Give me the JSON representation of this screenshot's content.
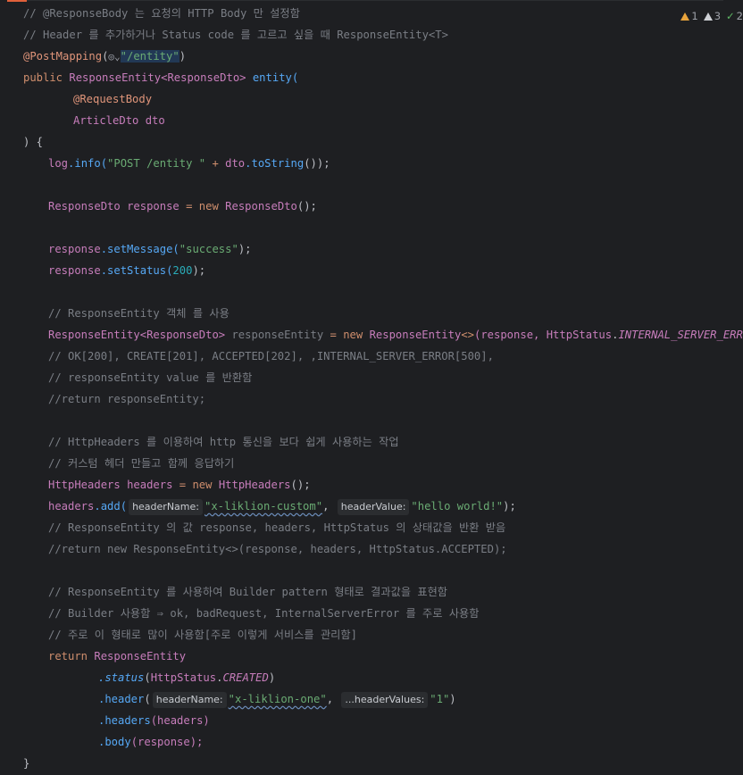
{
  "inspections": {
    "errors": "1",
    "warnings": "3",
    "ok": "2"
  },
  "code": {
    "l1": "// @ResponseBody 는 요청의 HTTP Body 만 설정함",
    "l2": "// Header 를 추가하거나 Status code 를 고르고 싶을 때 ResponseEntity<T>",
    "l3_ann": "@PostMapping",
    "l3_url": "\"/entity\"",
    "l4_public": "public",
    "l4_type": "ResponseEntity",
    "l4_generic": "<ResponseDto>",
    "l4_name": "entity(",
    "l5": "@RequestBody",
    "l6_type": "ArticleDto",
    "l6_var": "dto",
    "l7": ") {",
    "l8_log": "log",
    "l8_info": ".info(",
    "l8_str": "\"POST /entity \"",
    "l8_plus": " + ",
    "l8_dto": "dto",
    "l8_tostr": ".toString",
    "l8_end": "());",
    "l10_type": "ResponseDto",
    "l10_var": "response",
    "l10_eq": " = ",
    "l10_new": "new",
    "l10_cls": "ResponseDto",
    "l10_end": "();",
    "l12_var": "response",
    "l12_fn": ".setMessage(",
    "l12_str": "\"success\"",
    "l12_end": ");",
    "l13_var": "response",
    "l13_fn": ".setStatus(",
    "l13_num": "200",
    "l13_end": ");",
    "l15": "// ResponseEntity 객체 를 사용",
    "l16_type": "ResponseEntity",
    "l16_gen": "<ResponseDto>",
    "l16_var": "responseEntity",
    "l16_eq": " = ",
    "l16_new": "new",
    "l16_cls": "ResponseEntity",
    "l16_diamond": "<>",
    "l16_args": "(response, ",
    "l16_hs": "HttpStatus",
    "l16_dot": ".",
    "l16_field": "INTERNAL_SERVER_ERROR",
    "l16_end": ");",
    "l17": "// OK[200], CREATE[201], ACCEPTED[202], ,INTERNAL_SERVER_ERROR[500],",
    "l18": "// responseEntity value 를 반환함",
    "l19": "//return responseEntity;",
    "l21": "// HttpHeaders 를 이용하여 http 통신을 보다 쉽게 사용하는 작업",
    "l22": "// 커스텀 헤더 만들고 함께 응답하기",
    "l23_type": "HttpHeaders",
    "l23_var": "headers",
    "l23_eq": " = ",
    "l23_new": "new",
    "l23_cls": "HttpHeaders",
    "l23_end": "();",
    "l24_var": "headers",
    "l24_fn": ".add(",
    "l24_hint1": "headerName:",
    "l24_str1": "\"x-liklion-custom\"",
    "l24_comma": ",",
    "l24_hint2": "headerValue:",
    "l24_str2": "\"hello world!\"",
    "l24_end": ");",
    "l25": "// ResponseEntity 의 값 response, headers, HttpStatus 의 상태값을 반환 받음",
    "l26": "//return new ResponseEntity<>(response, headers, HttpStatus.ACCEPTED);",
    "l28": "// ResponseEntity 를 사용하여 Builder pattern 형태로 결과값을 표현함",
    "l29": "// Builder 사용함 ⇒ ok, badRequest, InternalServerError 를 주로 사용함",
    "l30": "// 주로 이 형태로 많이 사용함[주로 이렇게 서비스를 관리함]",
    "l31_ret": "return",
    "l31_cls": "ResponseEntity",
    "l32_fn": ".status",
    "l32_open": "(",
    "l32_hs": "HttpStatus",
    "l32_dot": ".",
    "l32_field": "CREATED",
    "l32_end": ")",
    "l33_fn": ".header",
    "l33_open": "(",
    "l33_hint1": "headerName:",
    "l33_str1": "\"x-liklion-one\"",
    "l33_comma": ",",
    "l33_hint2": "...headerValues:",
    "l33_str2": "\"1\"",
    "l33_end": ")",
    "l34_fn": ".headers",
    "l34_arg": "(headers)",
    "l35_fn": ".body",
    "l35_arg": "(response);",
    "l36": "}"
  },
  "colors": {
    "background": "#1e1f22",
    "keyword": "#cf8e6d",
    "class": "#c77dbb",
    "function": "#56a8f5",
    "string": "#6aab73",
    "number": "#2aacb8",
    "comment": "#7a7e85"
  },
  "icons": {
    "error": "warning-triangle-icon",
    "warning": "weak-warning-icon",
    "ok": "check-icon",
    "url": "globe-icon"
  }
}
